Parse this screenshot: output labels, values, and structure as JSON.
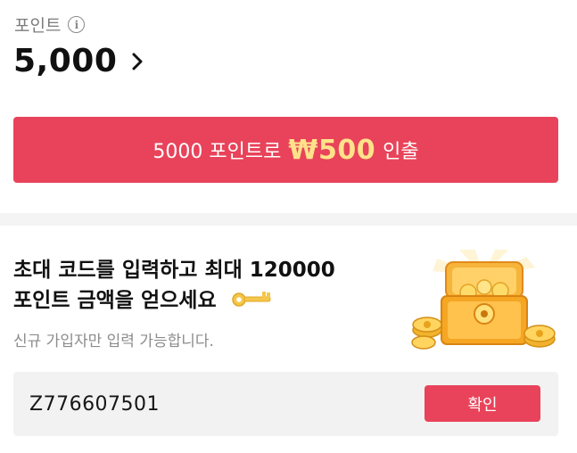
{
  "points": {
    "label": "포인트",
    "info_icon_glyph": "i",
    "balance": "5,000"
  },
  "withdraw": {
    "prefix": "5000 포인트로",
    "amount": "₩500",
    "suffix": "인출",
    "accent_color": "#ffe28a",
    "button_color": "#e8435a"
  },
  "invite": {
    "title_line1": "초대 코드를 입력하고 최대 120000",
    "title_line2": "포인트 금액을 얻으세요",
    "subtitle": "신규 가입자만 입력 가능합니다.",
    "code_value": "Z776607501",
    "confirm_label": "확인"
  },
  "icons": {
    "info": "info-icon",
    "chevron": "chevron-right-icon",
    "key": "key-icon",
    "chest": "treasure-chest-icon"
  }
}
